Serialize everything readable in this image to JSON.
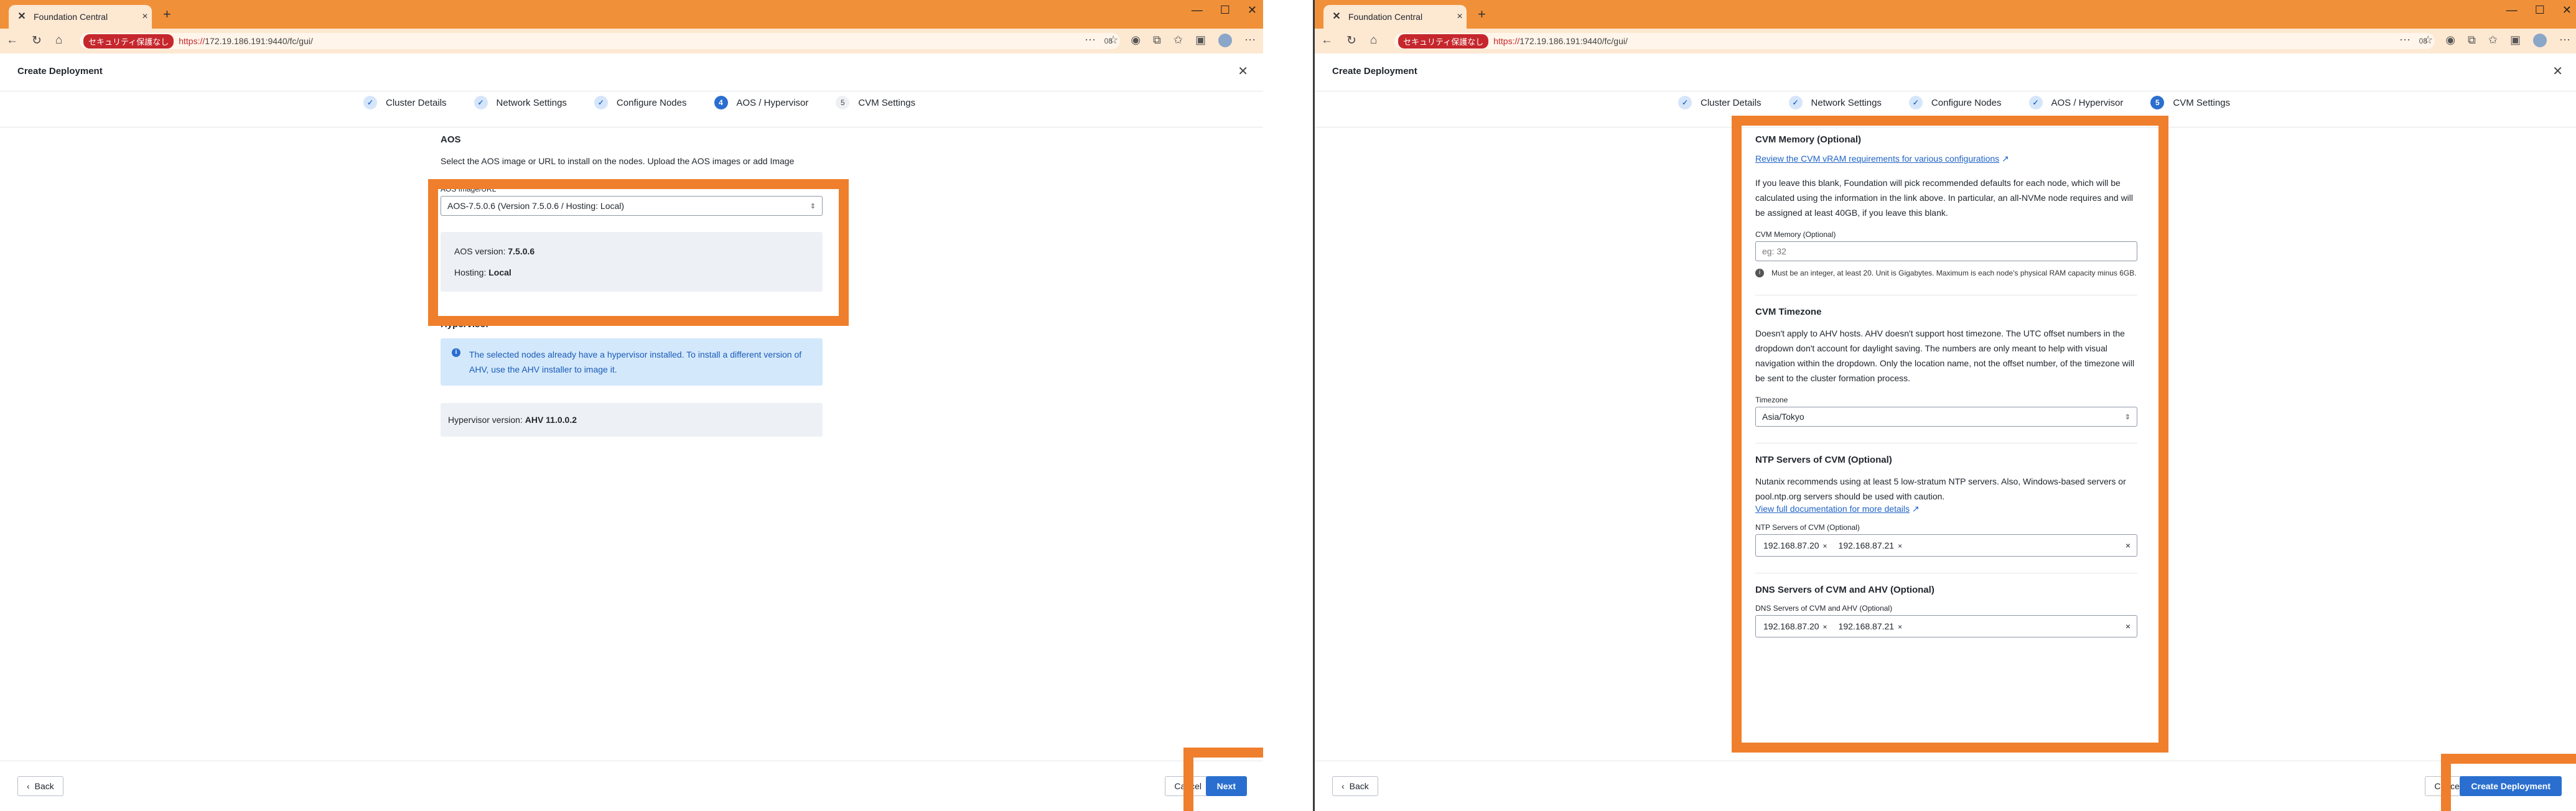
{
  "browser": {
    "tab_title": "Foundation Central",
    "security_badge": "セキュリティ保護なし",
    "url_scheme": "https://",
    "url_host": "172.19.186.191:9440/fc/gui/",
    "zoom": "08"
  },
  "modal": {
    "title": "Create Deployment"
  },
  "steps": [
    {
      "label": "Cluster Details",
      "state": "done"
    },
    {
      "label": "Network Settings",
      "state": "done"
    },
    {
      "label": "Configure Nodes",
      "state": "done"
    },
    {
      "label": "AOS / Hypervisor",
      "state": "active",
      "num": "4"
    },
    {
      "label": "CVM Settings",
      "state": "todo",
      "num": "5"
    }
  ],
  "steps_right": [
    {
      "label": "AOS / Hypervisor",
      "state": "done"
    },
    {
      "label": "CVM Settings",
      "state": "active",
      "num": "5"
    }
  ],
  "left": {
    "aos_heading": "AOS",
    "aos_desc": "Select the AOS image or URL to install on the nodes. Upload the AOS images or add Image",
    "aos_field_label": "AOS Image/URL",
    "aos_selected": "AOS-7.5.0.6   (Version 7.5.0.6 / Hosting: Local)",
    "aos_version_label": "AOS version:",
    "aos_version": "7.5.0.6",
    "hosting_label": "Hosting:",
    "hosting": "Local",
    "hypervisor_heading": "Hypervisor",
    "hypervisor_alert": "The selected nodes already have a hypervisor installed. To install a different version of AHV, use the AHV installer to image it.",
    "hypervisor_version_label": "Hypervisor version:",
    "hypervisor_version": "AHV 11.0.0.2"
  },
  "right": {
    "cvm_memory_heading": "CVM Memory (Optional)",
    "cvm_memory_link": "Review the CVM vRAM requirements for various configurations",
    "cvm_memory_desc": "If you leave this blank, Foundation will pick recommended defaults for each node, which will be calculated using the information in the link above. In particular, an all-NVMe node requires and will be assigned at least 40GB, if you leave this blank.",
    "cvm_memory_field_label": "CVM Memory (Optional)",
    "cvm_memory_placeholder": "eg: 32",
    "cvm_memory_hint": "Must be an integer, at least 20. Unit is Gigabytes. Maximum is each node's physical RAM capacity minus 6GB.",
    "timezone_heading": "CVM Timezone",
    "timezone_desc": "Doesn't apply to AHV hosts. AHV doesn't support host timezone. The UTC offset numbers in the dropdown don't account for daylight saving. The numbers are only meant to help with visual navigation within the dropdown. Only the location name, not the offset number, of the timezone will be sent to the cluster formation process.",
    "timezone_label": "Timezone",
    "timezone_value": "Asia/Tokyo",
    "ntp_heading": "NTP Servers of CVM (Optional)",
    "ntp_desc": "Nutanix recommends using at least 5 low-stratum NTP servers. Also, Windows-based servers or pool.ntp.org servers should be used with caution.",
    "ntp_link": "View full documentation for more details",
    "ntp_field_label": "NTP Servers of CVM (Optional)",
    "ntp_servers": [
      "192.168.87.20",
      "192.168.87.21"
    ],
    "dns_heading": "DNS Servers of CVM and AHV (Optional)",
    "dns_field_label": "DNS Servers of CVM and AHV (Optional)",
    "dns_servers": [
      "192.168.87.20",
      "192.168.87.21"
    ]
  },
  "footer": {
    "back": "Back",
    "cancel": "Cancel",
    "next": "Next",
    "create": "Create Deployment"
  },
  "colors": {
    "accent": "#2a6fcf",
    "highlight": "#ef7f2c",
    "tabbar": "#f0913a"
  }
}
